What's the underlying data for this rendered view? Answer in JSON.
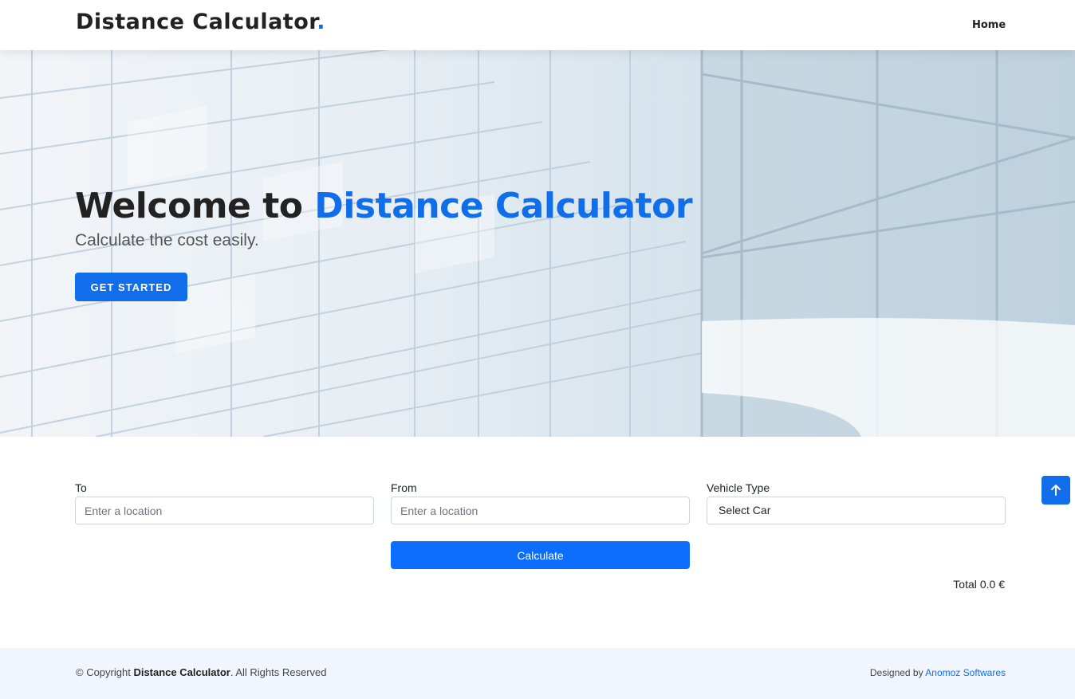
{
  "header": {
    "logo_text": "Distance Calculator",
    "logo_dot": ".",
    "nav": {
      "home": "Home"
    }
  },
  "hero": {
    "title_prefix": "Welcome to ",
    "title_accent": "Distance Calculator",
    "subtitle": "Calculate the cost easily.",
    "cta_label": "GET STARTED"
  },
  "form": {
    "to": {
      "label": "To",
      "placeholder": "Enter a location",
      "value": ""
    },
    "from": {
      "label": "From",
      "placeholder": "Enter a location",
      "value": ""
    },
    "vehicle": {
      "label": "Vehicle Type",
      "selected": "Select Car"
    },
    "calculate_label": "Calculate",
    "total_label": "Total",
    "total_value": "0.0 €"
  },
  "back_to_top": {
    "icon": "arrow-up-icon"
  },
  "footer": {
    "copyright_prefix": "© Copyright ",
    "brand": "Distance Calculator",
    "copyright_suffix": ". All Rights Reserved",
    "designed_by": "Designed by ",
    "designer": "Anomoz Softwares"
  },
  "colors": {
    "accent": "#106eea",
    "button_primary": "#0d6efd",
    "footer_bg": "#f1f6fe"
  }
}
